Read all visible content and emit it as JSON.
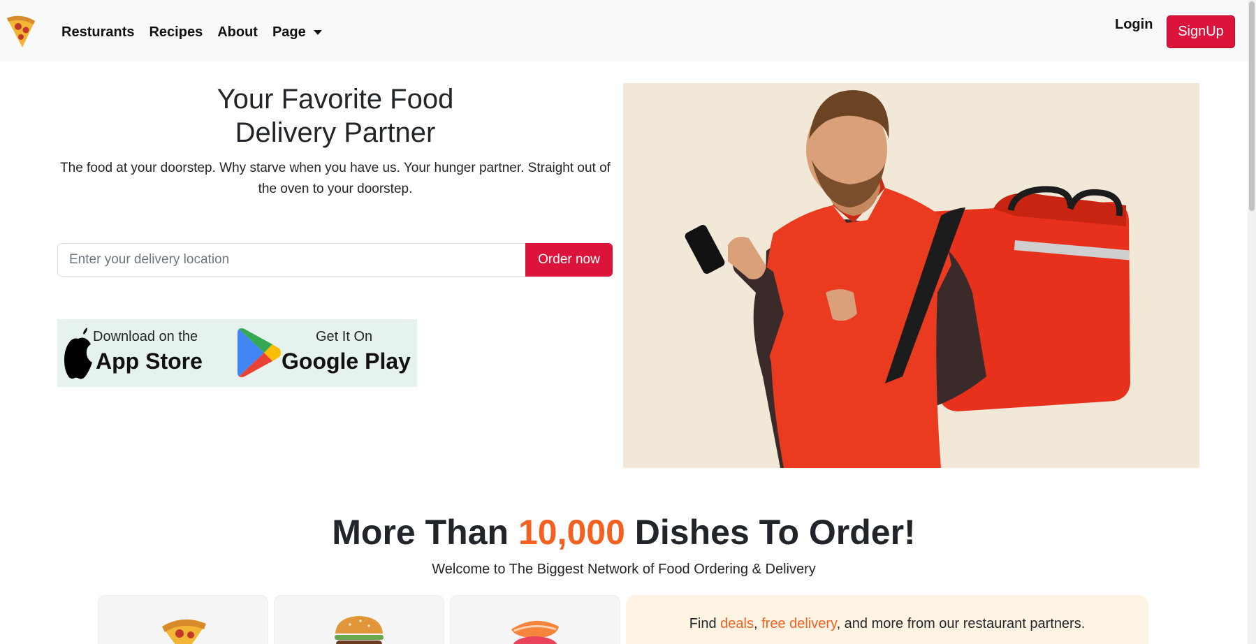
{
  "nav": {
    "logo_icon": "pizza-slice-icon",
    "links": [
      "Resturants",
      "Recipes",
      "About"
    ],
    "dropdown_label": "Page",
    "login": "Login",
    "signup": "SignUp"
  },
  "hero": {
    "title_line1": "Your Favorite Food",
    "title_line2": "Delivery Partner",
    "subtitle": "The food at your doorstep. Why starve when you have us. Your hunger partner. Straight out of the oven to your doorstep.",
    "search_placeholder": "Enter your delivery location",
    "order_button": "Order now",
    "image_icon": "delivery-person-photo"
  },
  "stores": {
    "apple_small": "Download on the",
    "apple_big": "App Store",
    "google_small": "Get It On",
    "google_big": "Google Play"
  },
  "section": {
    "title_prefix": "More Than ",
    "title_accent": "10,000",
    "title_suffix": " Dishes To Order!",
    "welcome": "Welcome to The Biggest Network of Food Ordering & Delivery",
    "food_cards": [
      "pizza-icon",
      "burger-icon",
      "sushi-icon"
    ],
    "deals_prefix": "Find ",
    "deals_link1": "deals",
    "deals_sep": ", ",
    "deals_link2": "free delivery",
    "deals_suffix": ", and more from our restaurant partners."
  },
  "colors": {
    "brand_red": "#dc143c",
    "accent_orange": "#f26122",
    "navbar_bg": "#f8f9fa",
    "store_bg": "#e6f2ee",
    "deals_bg": "#fff4e3"
  }
}
